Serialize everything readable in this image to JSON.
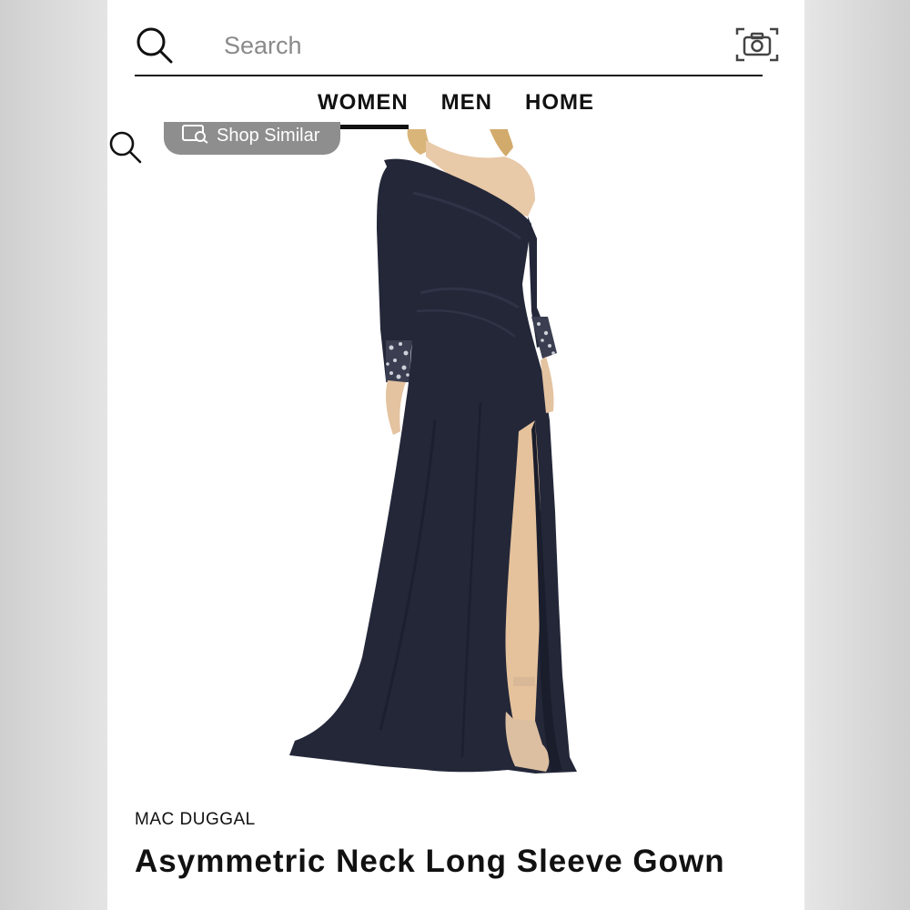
{
  "search": {
    "placeholder": "Search",
    "icon": "search-icon",
    "camera_icon": "camera-icon"
  },
  "nav": {
    "tabs": [
      {
        "label": "WOMEN",
        "active": true
      },
      {
        "label": "MEN",
        "active": false
      },
      {
        "label": "HOME",
        "active": false
      }
    ]
  },
  "product": {
    "shop_similar_label": "Shop Similar",
    "brand": "MAC DUGGAL",
    "title": "Asymmetric Neck Long Sleeve Gown",
    "image_alt": "navy one-shoulder gown with embellished cuffs and side slit",
    "zoom_icon": "zoom-icon"
  },
  "colors": {
    "gown": "#232738",
    "accent": "#111111",
    "badge": "#8e8e8e"
  }
}
